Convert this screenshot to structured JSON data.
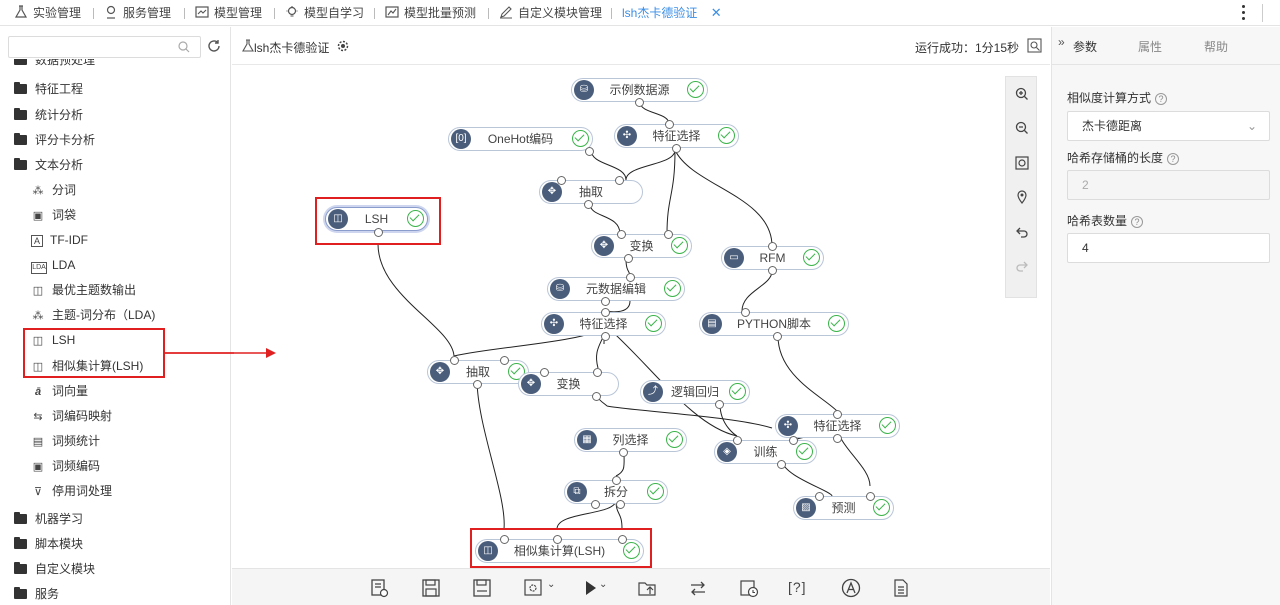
{
  "top_tabs": [
    {
      "label": "实验管理",
      "icon": "flask-icon"
    },
    {
      "label": "服务管理",
      "icon": "location-pin-icon"
    },
    {
      "label": "模型管理",
      "icon": "chart-box-icon"
    },
    {
      "label": "模型自学习",
      "icon": "lightbulb-icon"
    },
    {
      "label": "模型批量预测",
      "icon": "chart-line-icon"
    },
    {
      "label": "自定义模块管理",
      "icon": "edit-icon"
    },
    {
      "label": "lsh杰卡德验证",
      "icon": "",
      "active": true
    }
  ],
  "sidebar": {
    "search_placeholder": "",
    "items": [
      {
        "label": "数据预处理",
        "type": "folder"
      },
      {
        "label": "特征工程",
        "type": "folder"
      },
      {
        "label": "统计分析",
        "type": "folder"
      },
      {
        "label": "评分卡分析",
        "type": "folder"
      },
      {
        "label": "文本分析",
        "type": "folder-open"
      },
      {
        "label": "分词",
        "type": "leaf",
        "icon": "⁂"
      },
      {
        "label": "词袋",
        "type": "leaf",
        "icon": "▣"
      },
      {
        "label": "TF-IDF",
        "type": "leaf",
        "icon": "A"
      },
      {
        "label": "LDA",
        "type": "leaf",
        "icon": "LDA"
      },
      {
        "label": "最优主题数输出",
        "type": "leaf",
        "icon": "◫"
      },
      {
        "label": "主题-词分布（LDA)",
        "type": "leaf",
        "icon": "⁂"
      },
      {
        "label": "LSH",
        "type": "leaf",
        "icon": "◫"
      },
      {
        "label": "相似集计算(LSH)",
        "type": "leaf",
        "icon": "◫"
      },
      {
        "label": "词向量",
        "type": "leaf",
        "icon": "ā"
      },
      {
        "label": "词编码映射",
        "type": "leaf",
        "icon": "⇆"
      },
      {
        "label": "词频统计",
        "type": "leaf",
        "icon": "▤"
      },
      {
        "label": "词频编码",
        "type": "leaf",
        "icon": "▣"
      },
      {
        "label": "停用词处理",
        "type": "leaf",
        "icon": "⊽"
      },
      {
        "label": "机器学习",
        "type": "folder"
      },
      {
        "label": "脚本模块",
        "type": "folder"
      },
      {
        "label": "自定义模块",
        "type": "folder"
      },
      {
        "label": "服务",
        "type": "folder"
      }
    ]
  },
  "canvas_header": {
    "title": "lsh杰卡德验证",
    "run_status": "运行成功：1分15秒"
  },
  "nodes": [
    {
      "id": "n1",
      "label": "示例数据源"
    },
    {
      "id": "n2",
      "label": "OneHot编码"
    },
    {
      "id": "n3",
      "label": "特征选择"
    },
    {
      "id": "n4",
      "label": "LSH"
    },
    {
      "id": "n5",
      "label": "抽取"
    },
    {
      "id": "n6",
      "label": "变换"
    },
    {
      "id": "n7",
      "label": "RFM"
    },
    {
      "id": "n8",
      "label": "元数据编辑"
    },
    {
      "id": "n9",
      "label": "特征选择"
    },
    {
      "id": "n10",
      "label": "PYTHON脚本"
    },
    {
      "id": "n11",
      "label": "抽取"
    },
    {
      "id": "n12",
      "label": "变换"
    },
    {
      "id": "n13",
      "label": "逻辑回归"
    },
    {
      "id": "n14",
      "label": "特征选择"
    },
    {
      "id": "n15",
      "label": "列选择"
    },
    {
      "id": "n16",
      "label": "训练"
    },
    {
      "id": "n17",
      "label": "拆分"
    },
    {
      "id": "n18",
      "label": "预测"
    },
    {
      "id": "n19",
      "label": "相似集计算(LSH)"
    }
  ],
  "zoom_tools": [
    "zoom-in-icon",
    "zoom-out-icon",
    "fit-icon",
    "locate-icon",
    "undo-icon",
    "redo-icon"
  ],
  "bottom_tools": [
    "run-log-icon",
    "save-icon",
    "save-as-icon",
    "settings-icon",
    "run-icon",
    "export-icon",
    "swap-icon",
    "schedule-icon",
    "help-bracket-icon",
    "font-icon",
    "document-icon"
  ],
  "bottom_help_text": "[?]",
  "right_panel": {
    "tabs": [
      "参数",
      "属性",
      "帮助"
    ],
    "fields": [
      {
        "label": "相似度计算方式",
        "value": "杰卡德距离",
        "kind": "select"
      },
      {
        "label": "哈希存储桶的长度",
        "value": "2",
        "kind": "disabled"
      },
      {
        "label": "哈希表数量",
        "value": "4",
        "kind": "input"
      }
    ]
  },
  "colors": {
    "accent": "#3a8ee6",
    "annotation_red": "#e02020",
    "success_green": "#3bb44a",
    "node_icon_bg": "#4a5d7a"
  }
}
